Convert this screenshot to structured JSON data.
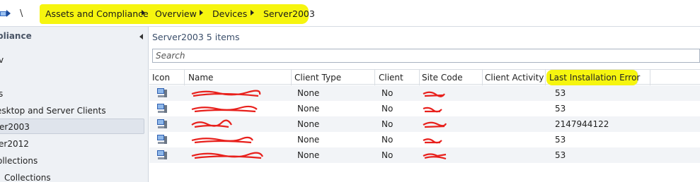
{
  "breadcrumb": {
    "root_separator": "\\",
    "items": [
      "Assets and Compliance",
      "Overview",
      "Devices",
      "Server2003"
    ]
  },
  "nav": {
    "header": "pliance",
    "items": [
      {
        "label": "v"
      },
      {
        "label": "s"
      },
      {
        "label": "esktop and Server Clients"
      },
      {
        "label": "er2003"
      },
      {
        "label": "er2012"
      },
      {
        "label": "ollections"
      },
      {
        "label": "Collections"
      }
    ]
  },
  "panel": {
    "title": "Server2003",
    "count": "5 items",
    "search_placeholder": "Search"
  },
  "grid": {
    "columns": [
      "Icon",
      "Name",
      "Client Type",
      "Client",
      "Site Code",
      "Client Activity",
      "Last Installation Error"
    ],
    "rows": [
      {
        "client_type": "None",
        "client": "No",
        "last_error": "53"
      },
      {
        "client_type": "None",
        "client": "No",
        "last_error": "53"
      },
      {
        "client_type": "None",
        "client": "No",
        "last_error": "2147944122"
      },
      {
        "client_type": "None",
        "client": "No",
        "last_error": "53"
      },
      {
        "client_type": "None",
        "client": "No",
        "last_error": "53"
      }
    ]
  },
  "colors": {
    "highlight": "#f6f50f",
    "redaction": "#e8201c",
    "nav_background": "#eef1f5",
    "selected_row": "#dfe4ec"
  }
}
